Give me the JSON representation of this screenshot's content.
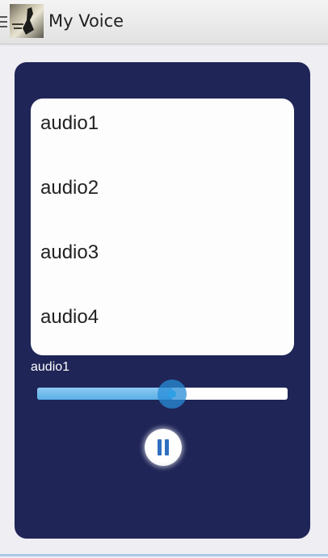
{
  "app": {
    "title": "My Voice",
    "menu_icon": "hamburger-menu-icon",
    "logo_icon": "app-logo-icon"
  },
  "playlist": {
    "items": [
      {
        "label": "audio1"
      },
      {
        "label": "audio2"
      },
      {
        "label": "audio3"
      },
      {
        "label": "audio4"
      }
    ]
  },
  "player": {
    "current_track": "audio1",
    "progress_fraction": 0.54,
    "control_icon": "pause-icon"
  },
  "colors": {
    "card_background": "#1f2557",
    "list_background": "#fdfdfe",
    "seek_fill": "#58aee7",
    "pause_icon": "#2f6fbf"
  }
}
